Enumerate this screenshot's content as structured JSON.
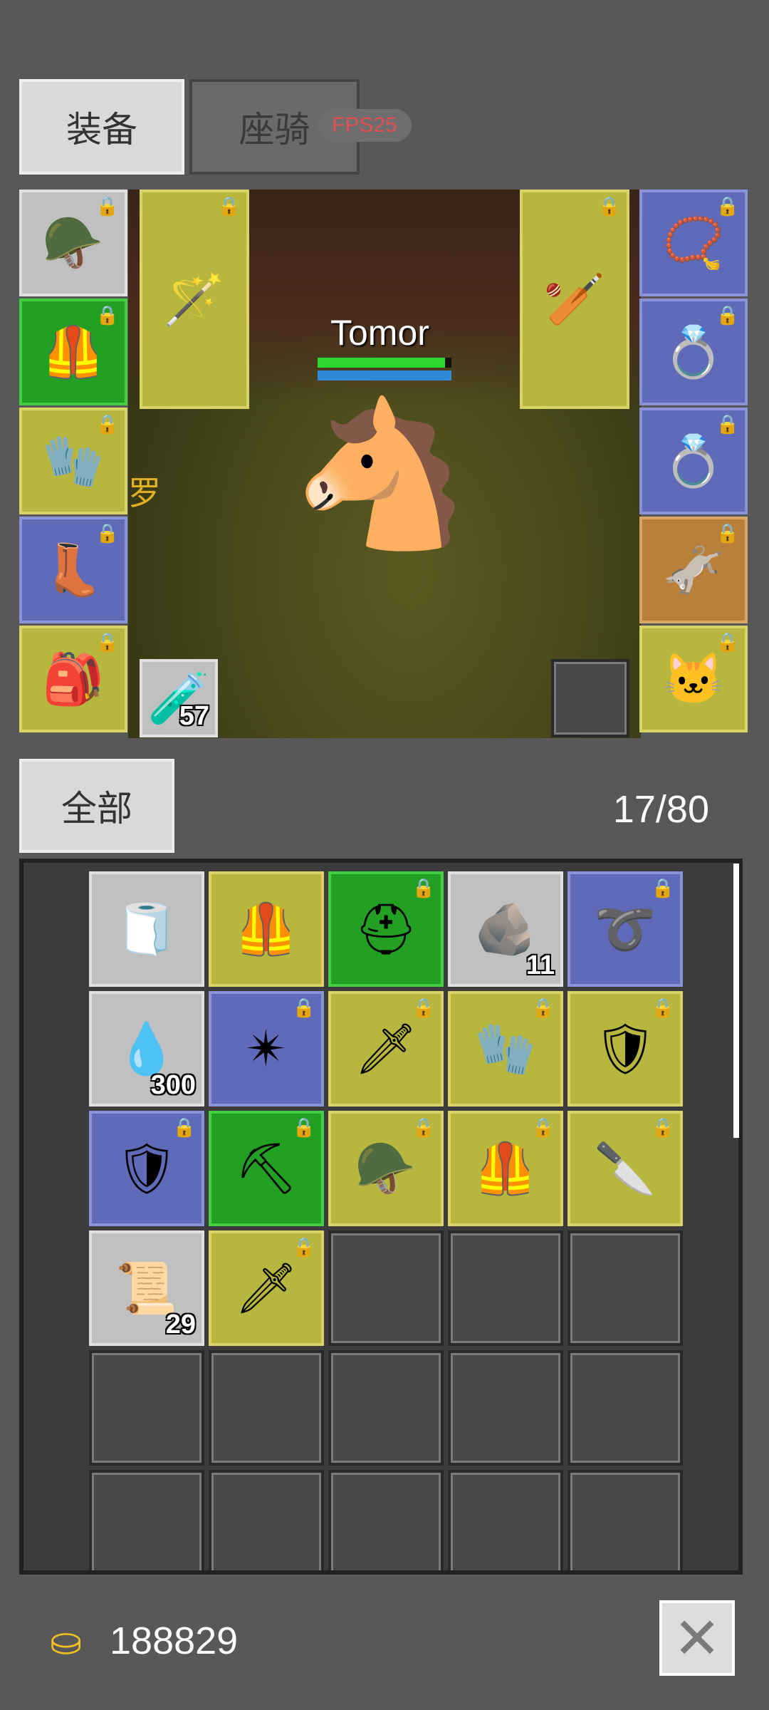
{
  "tabs": {
    "equipment": "装备",
    "mount": "座骑"
  },
  "fps_badge": "FPS25",
  "character": {
    "name": "Tomor",
    "hp_fraction": 0.95,
    "mp_fraction": 1.0
  },
  "scene_text": "罗",
  "equipment": {
    "left": [
      {
        "icon": "helmet-icon",
        "rarity": "gray",
        "locked": true,
        "glyph": "🪖"
      },
      {
        "icon": "armor-icon",
        "rarity": "green",
        "locked": true,
        "glyph": "🦺"
      },
      {
        "icon": "glove-icon",
        "rarity": "yellow",
        "locked": true,
        "glyph": "🧤"
      },
      {
        "icon": "boots-icon",
        "rarity": "blue",
        "locked": true,
        "glyph": "👢"
      },
      {
        "icon": "belt-icon",
        "rarity": "yellow",
        "locked": true,
        "glyph": "🎒"
      }
    ],
    "right": [
      {
        "icon": "amulet-icon",
        "rarity": "blue",
        "locked": true,
        "glyph": "📿"
      },
      {
        "icon": "ring-blue-icon",
        "rarity": "blue",
        "locked": true,
        "glyph": "💍"
      },
      {
        "icon": "ring-purple-icon",
        "rarity": "blue",
        "locked": true,
        "glyph": "💍"
      },
      {
        "icon": "donkey-mount-icon",
        "rarity": "orange",
        "locked": true,
        "glyph": "🫏"
      },
      {
        "icon": "pet-cat-icon",
        "rarity": "yellow",
        "locked": true,
        "glyph": "🐱"
      }
    ],
    "weapon_main": {
      "icon": "staff-icon",
      "rarity": "yellow",
      "locked": true,
      "glyph": "🪄"
    },
    "weapon_off": {
      "icon": "club-icon",
      "rarity": "yellow",
      "locked": true,
      "glyph": "🏏"
    },
    "potion": {
      "icon": "red-potion-icon",
      "count": "57",
      "glyph": "🧪"
    }
  },
  "inventory": {
    "filter_label": "全部",
    "capacity": "17/80",
    "items": [
      {
        "icon": "cloth-icon",
        "rarity": "gray",
        "locked": false,
        "count": "",
        "glyph": "🧻"
      },
      {
        "icon": "leather-armor-icon",
        "rarity": "yellow",
        "locked": false,
        "count": "",
        "glyph": "🦺"
      },
      {
        "icon": "gold-helm-icon",
        "rarity": "green",
        "locked": true,
        "count": "",
        "glyph": "⛑"
      },
      {
        "icon": "ore-icon",
        "rarity": "gray",
        "locked": false,
        "count": "11",
        "glyph": "🪨"
      },
      {
        "icon": "belt-icon",
        "rarity": "blue",
        "locked": true,
        "count": "",
        "glyph": "➰"
      },
      {
        "icon": "blue-gem-icon",
        "rarity": "gray",
        "locked": false,
        "count": "300",
        "glyph": "💧"
      },
      {
        "icon": "spiked-shield-icon",
        "rarity": "blue",
        "locked": true,
        "count": "",
        "glyph": "✴"
      },
      {
        "icon": "sword-icon",
        "rarity": "yellow",
        "locked": true,
        "count": "",
        "glyph": "🗡"
      },
      {
        "icon": "glove-icon",
        "rarity": "yellow",
        "locked": true,
        "count": "",
        "glyph": "🧤"
      },
      {
        "icon": "round-shield-icon",
        "rarity": "yellow",
        "locked": true,
        "count": "",
        "glyph": "🛡"
      },
      {
        "icon": "round-shield-icon",
        "rarity": "blue",
        "locked": true,
        "count": "",
        "glyph": "🛡"
      },
      {
        "icon": "pickaxe-icon",
        "rarity": "green",
        "locked": true,
        "count": "",
        "glyph": "⛏"
      },
      {
        "icon": "horned-helmet-icon",
        "rarity": "yellow",
        "locked": true,
        "count": "",
        "glyph": "🪖"
      },
      {
        "icon": "leather-armor-icon",
        "rarity": "yellow",
        "locked": true,
        "count": "",
        "glyph": "🦺"
      },
      {
        "icon": "short-sword-icon",
        "rarity": "yellow",
        "locked": true,
        "count": "",
        "glyph": "🔪"
      },
      {
        "icon": "scroll-icon",
        "rarity": "gray",
        "locked": false,
        "count": "29",
        "glyph": "📜"
      },
      {
        "icon": "dagger-icon",
        "rarity": "yellow",
        "locked": true,
        "count": "",
        "glyph": "🗡"
      }
    ]
  },
  "footer": {
    "gold_icon": "gold-coins-icon",
    "gold": "188829",
    "close_icon": "close-icon",
    "close_glyph": "✕"
  },
  "colors": {
    "gray": "#c0c0c0",
    "yellow": "#b7b63e",
    "green": "#23a023",
    "blue": "#5f6bb8",
    "orange": "#b8803a",
    "hp": "#2ed82e",
    "mp": "#2e8ad8"
  }
}
